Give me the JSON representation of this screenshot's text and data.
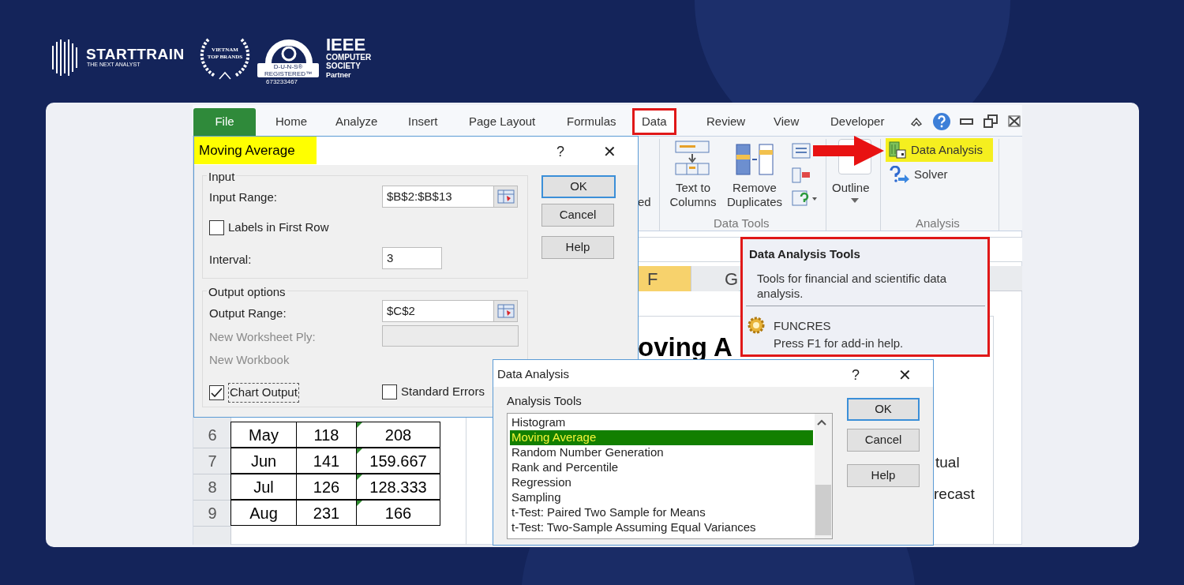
{
  "brand": {
    "name": "STARTTRAIN",
    "tagline": "THE NEXT ANALYST",
    "award": [
      "VIETNAM",
      "TOP BRANDS"
    ],
    "duns": [
      "D-U-N-S®",
      "REGISTERED™",
      "673233467"
    ],
    "ieee": [
      "IEEE",
      "COMPUTER",
      "SOCIETY",
      "Partner"
    ]
  },
  "ribbon": {
    "tabs": [
      {
        "label": "File",
        "kind": "file",
        "selected": false
      },
      {
        "label": "Home",
        "kind": "tab",
        "selected": false
      },
      {
        "label": "Analyze",
        "kind": "tab",
        "selected": false
      },
      {
        "label": "Insert",
        "kind": "tab",
        "selected": false
      },
      {
        "label": "Page Layout",
        "kind": "tab",
        "selected": false
      },
      {
        "label": "Formulas",
        "kind": "tab",
        "selected": false
      },
      {
        "label": "Data",
        "kind": "tab",
        "selected": true
      },
      {
        "label": "Review",
        "kind": "tab",
        "selected": false
      },
      {
        "label": "View",
        "kind": "tab",
        "selected": false
      },
      {
        "label": "Developer",
        "kind": "tab",
        "selected": false
      }
    ],
    "cut_label": "ed",
    "data_tools": {
      "buttons": [
        "Text to Columns",
        "Remove Duplicates"
      ],
      "label": "Data Tools"
    },
    "outline": "Outline",
    "analysis": {
      "items": [
        {
          "label": "Data Analysis",
          "kind": "data",
          "highlighted": true
        },
        {
          "label": "Solver",
          "kind": "solver",
          "highlighted": false
        }
      ],
      "label": "Analysis"
    }
  },
  "tooltip": {
    "title": "Data Analysis Tools",
    "description": "Tools for financial and scientific data analysis.",
    "addin": "FUNCRES",
    "addin_help": "Press F1 for add-in help."
  },
  "sheet": {
    "columns": [
      {
        "label": "F",
        "selected": true
      },
      {
        "label": "G",
        "selected": false
      }
    ],
    "heading": "oving A",
    "side_texts": [
      "tual",
      "recast"
    ],
    "rows": [
      {
        "number": "6",
        "month": "May",
        "value": "118",
        "average": "208",
        "flagged": true
      },
      {
        "number": "7",
        "month": "Jun",
        "value": "141",
        "average": "159.667",
        "flagged": true
      },
      {
        "number": "8",
        "month": "Jul",
        "value": "126",
        "average": "128.333",
        "flagged": true
      },
      {
        "number": "9",
        "month": "Aug",
        "value": "231",
        "average": "166",
        "flagged": true
      }
    ]
  },
  "moving_average_dialog": {
    "title": "Moving Average",
    "help": "?",
    "close": "✕",
    "input_group": "Input",
    "input_range_label": "Input Range:",
    "input_range": "$B$2:$B$13",
    "labels_in_first_row": {
      "label": "Labels in First Row",
      "checked": false
    },
    "interval_label": "Interval:",
    "interval": "3",
    "output_group": "Output options",
    "output_range_label": "Output Range:",
    "output_range": "$C$2",
    "new_worksheet_ply": {
      "label": "New Worksheet Ply:",
      "disabled": true
    },
    "new_workbook": {
      "label": "New Workbook",
      "disabled": true
    },
    "chart_output": {
      "label": "Chart Output",
      "checked": true
    },
    "standard_errors": {
      "label": "Standard Errors",
      "checked": false
    },
    "buttons": [
      "OK",
      "Cancel",
      "Help"
    ]
  },
  "data_analysis_dialog": {
    "title": "Data Analysis",
    "help": "?",
    "close": "✕",
    "list_label": "Analysis Tools",
    "tools": [
      {
        "label": "Histogram",
        "selected": false
      },
      {
        "label": "Moving Average",
        "selected": true
      },
      {
        "label": "Random Number Generation",
        "selected": false
      },
      {
        "label": "Rank and Percentile",
        "selected": false
      },
      {
        "label": "Regression",
        "selected": false
      },
      {
        "label": "Sampling",
        "selected": false
      },
      {
        "label": "t-Test: Paired Two Sample for Means",
        "selected": false
      },
      {
        "label": "t-Test: Two-Sample Assuming Equal Variances",
        "selected": false
      }
    ],
    "buttons": [
      "OK",
      "Cancel",
      "Help"
    ]
  }
}
